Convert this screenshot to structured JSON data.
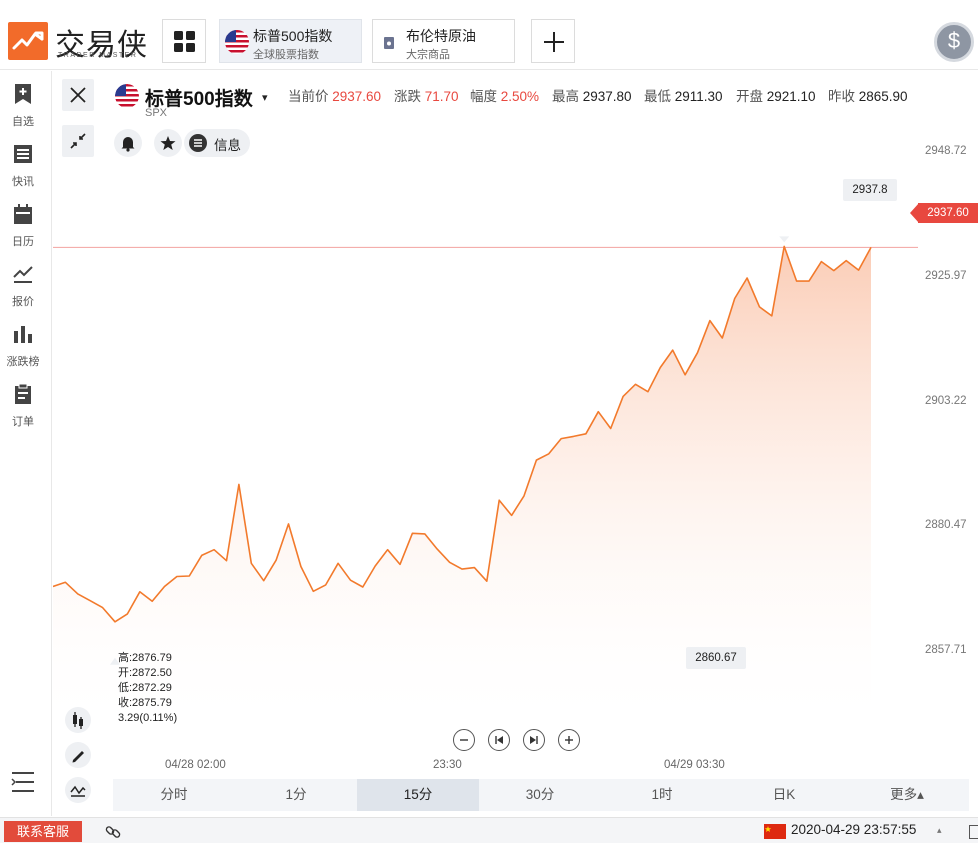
{
  "app": {
    "logo_text": "交易侠",
    "logo_sub": "TRADER MASTER"
  },
  "tabs": [
    {
      "title": "标普500指数",
      "subtitle": "全球股票指数",
      "active": true
    },
    {
      "title": "布伦特原油",
      "subtitle": "大宗商品",
      "active": false
    }
  ],
  "sidebar": {
    "items": [
      {
        "label": "自选",
        "icon": "bookmark-plus-icon"
      },
      {
        "label": "快讯",
        "icon": "news-list-icon"
      },
      {
        "label": "日历",
        "icon": "calendar-icon"
      },
      {
        "label": "报价",
        "icon": "quote-line-icon"
      },
      {
        "label": "涨跌榜",
        "icon": "bar-ranking-icon"
      },
      {
        "label": "订单",
        "icon": "clipboard-icon"
      }
    ]
  },
  "instrument": {
    "name": "标普500指数",
    "code": "SPX",
    "caret": "▾",
    "quotes": [
      {
        "key": "当前价",
        "value": "2937.60",
        "up": true
      },
      {
        "key": "涨跌",
        "value": "71.70",
        "up": true
      },
      {
        "key": "幅度",
        "value": "2.50%",
        "up": true
      },
      {
        "key": "最高",
        "value": "2937.80",
        "up": false
      },
      {
        "key": "最低",
        "value": "2911.30",
        "up": false
      },
      {
        "key": "开盘",
        "value": "2921.10",
        "up": false
      },
      {
        "key": "昨收",
        "value": "2865.90",
        "up": false
      }
    ],
    "info_label": "信息"
  },
  "chart_data": {
    "type": "area",
    "title": "",
    "xlabel": "",
    "ylabel": "",
    "ylim": [
      2845.0,
      2958.0
    ],
    "y_ticks": [
      "2948.72",
      "2925.97",
      "2903.22",
      "2880.47",
      "2857.71"
    ],
    "x_ticks": [
      "04/28 02:00",
      "23:30",
      "04/29 03:30"
    ],
    "current_price_label": "2937.60",
    "current_price": 2937.6,
    "max_label": "2937.8",
    "min_label": "2860.67",
    "series": [
      {
        "values": [
          2873.2,
          2874.0,
          2871.8,
          2870.5,
          2869.2,
          2866.5,
          2868.0,
          2872.2,
          2870.4,
          2873.2,
          2875.1,
          2875.2,
          2879.1,
          2880.2,
          2878.1,
          2892.6,
          2877.6,
          2874.3,
          2878.2,
          2885.1,
          2877.0,
          2872.3,
          2873.5,
          2877.6,
          2874.4,
          2873.1,
          2877.1,
          2880.2,
          2877.4,
          2883.3,
          2883.2,
          2880.3,
          2877.8,
          2876.5,
          2876.8,
          2874.2,
          2889.6,
          2886.7,
          2890.4,
          2897.2,
          2898.4,
          2901.3,
          2901.7,
          2902.2,
          2906.4,
          2903.2,
          2909.3,
          2911.6,
          2910.2,
          2914.8,
          2918.1,
          2913.4,
          2917.6,
          2923.7,
          2920.4,
          2927.9,
          2931.8,
          2926.3,
          2924.6,
          2937.8,
          2931.2,
          2931.2,
          2934.9,
          2933.2,
          2935.1,
          2933.3,
          2937.6
        ]
      }
    ]
  },
  "ohlc": {
    "high": "高:2876.79",
    "open": "开:2872.50",
    "low": "低:2872.29",
    "close": "收:2875.79",
    "change": "3.29(0.11%)"
  },
  "periods": [
    {
      "label": "分时",
      "active": false
    },
    {
      "label": "1分",
      "active": false
    },
    {
      "label": "15分",
      "active": true
    },
    {
      "label": "30分",
      "active": false
    },
    {
      "label": "1时",
      "active": false
    },
    {
      "label": "日K",
      "active": false
    },
    {
      "label": "更多▴",
      "active": false
    }
  ],
  "status": {
    "service_label": "联系客服",
    "datetime": "2020-04-29 23:57:55",
    "caret": "▴"
  },
  "colors": {
    "accent": "#f26b2a",
    "line": "#f27a2c",
    "up": "#e8483f",
    "price_line": "#f3a3a0"
  }
}
